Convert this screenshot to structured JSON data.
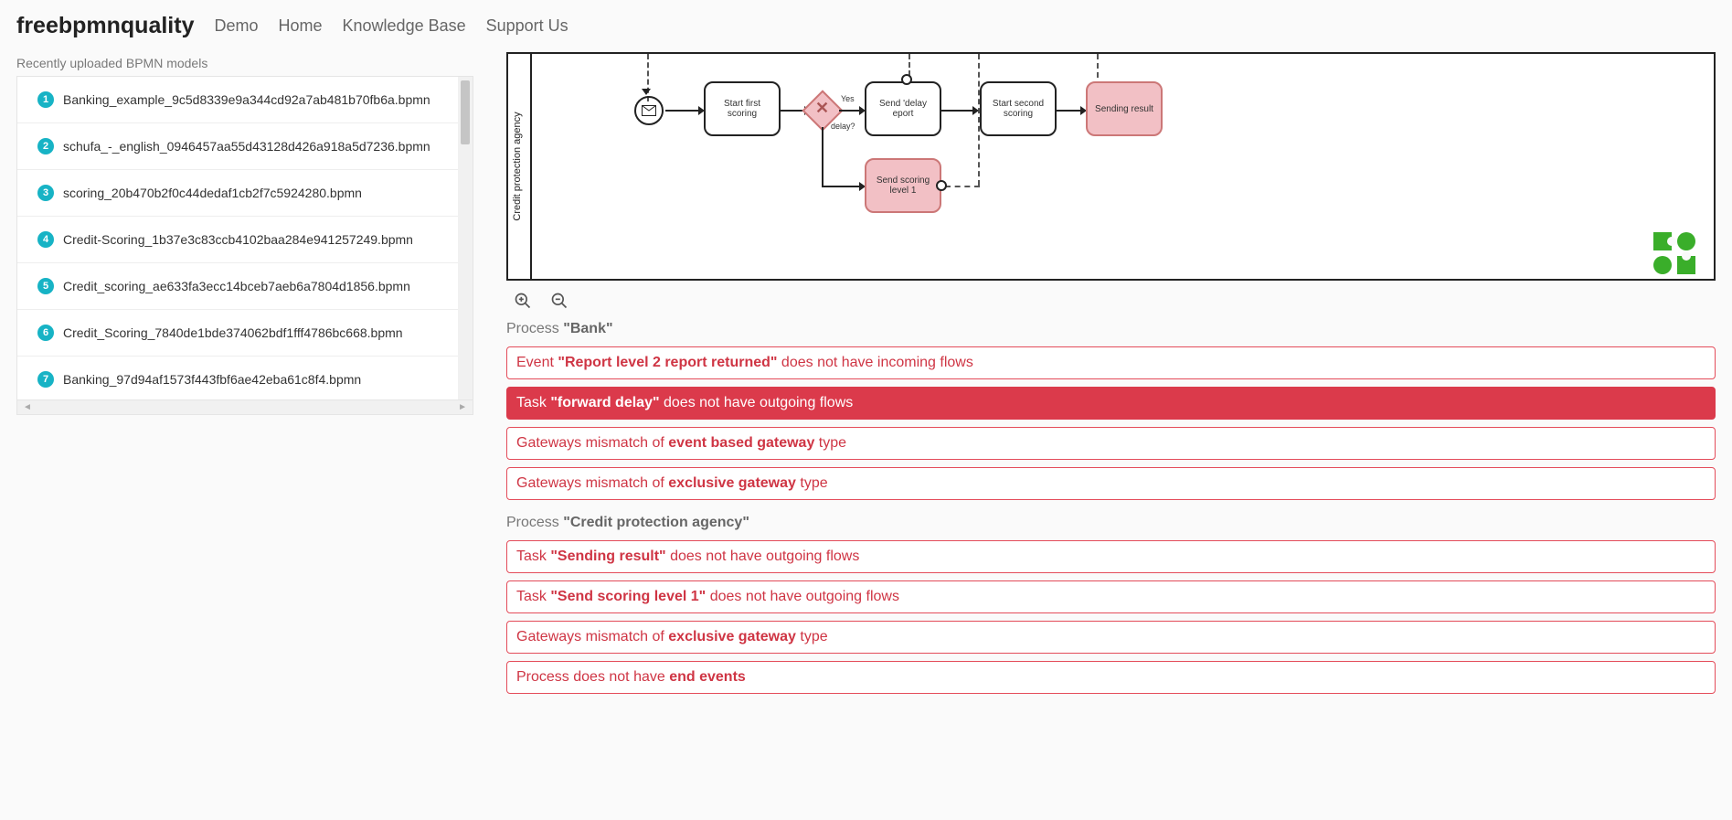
{
  "brand": "freebpmnquality",
  "nav": [
    "Demo",
    "Home",
    "Knowledge Base",
    "Support Us"
  ],
  "left_header": "Recently uploaded BPMN models",
  "models": [
    "Banking_example_9c5d8339e9a344cd92a7ab481b70fb6a.bpmn",
    "schufa_-_english_0946457aa55d43128d426a918a5d7236.bpmn",
    "scoring_20b470b2f0c44dedaf1cb2f7c5924280.bpmn",
    "Credit-Scoring_1b37e3c83ccb4102baa284e941257249.bpmn",
    "Credit_scoring_ae633fa3ecc14bceb7aeb6a7804d1856.bpmn",
    "Credit_Scoring_7840de1bde374062bdf1fff4786bc668.bpmn",
    "Banking_97d94af1573f443fbf6ae42eba61c8f4.bpmn"
  ],
  "diagram": {
    "lane": "Credit protection agency",
    "t1": "Start first scoring",
    "t2": "Send 'delay eport",
    "t3": "Start second scoring",
    "t4": "Sending result",
    "t5": "Send scoring level 1",
    "gw_label_yes": "Yes",
    "gw_label_q": "delay?"
  },
  "proc1": {
    "prefix": "Process ",
    "name": "\"Bank\""
  },
  "issues1": [
    {
      "p": "Event ",
      "b": "\"Report level 2 report returned\"",
      "s": " does not have incoming flows",
      "active": false
    },
    {
      "p": "Task ",
      "b": "\"forward delay\"",
      "s": " does not have outgoing flows",
      "active": true
    },
    {
      "p": "Gateways mismatch of ",
      "b": "event based gateway",
      "s": " type",
      "active": false
    },
    {
      "p": "Gateways mismatch of ",
      "b": "exclusive gateway",
      "s": " type",
      "active": false
    }
  ],
  "proc2": {
    "prefix": "Process ",
    "name": "\"Credit protection agency\""
  },
  "issues2": [
    {
      "p": "Task ",
      "b": "\"Sending result\"",
      "s": " does not have outgoing flows"
    },
    {
      "p": "Task ",
      "b": "\"Send scoring level 1\"",
      "s": " does not have outgoing flows"
    },
    {
      "p": "Gateways mismatch of ",
      "b": "exclusive gateway",
      "s": " type"
    },
    {
      "p": "Process does not have ",
      "b": "end events",
      "s": ""
    }
  ]
}
